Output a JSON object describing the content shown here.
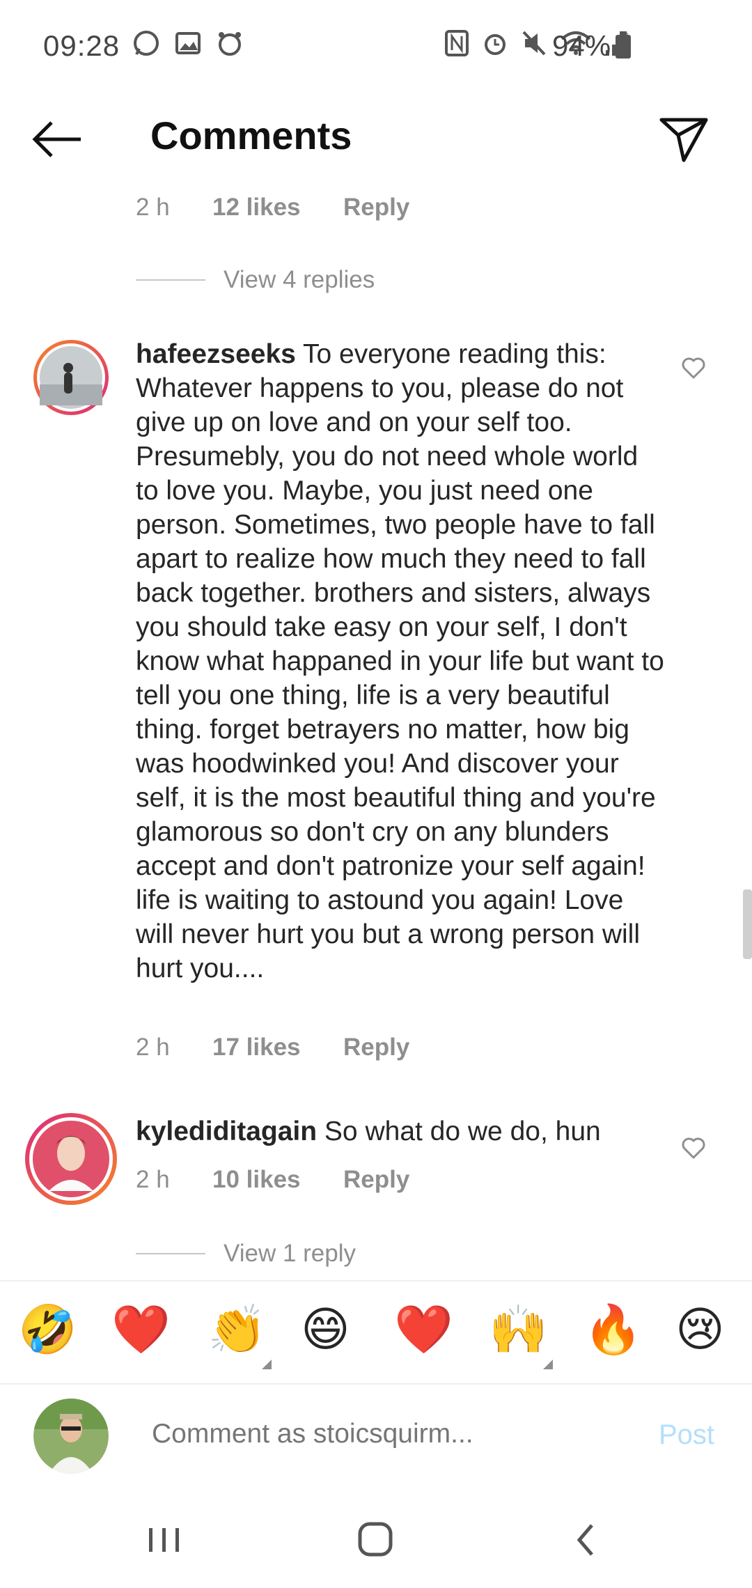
{
  "status_bar": {
    "time": "09:28",
    "battery": "94%",
    "left_icons": [
      "whatsapp-icon",
      "gallery-icon",
      "alarm-app-icon"
    ],
    "right_icons": [
      "nfc-icon",
      "alarm-icon",
      "mute-icon",
      "wifi-icon",
      "signal-icon",
      "battery-icon"
    ]
  },
  "header": {
    "title": "Comments",
    "back_icon": "arrow-left-icon",
    "share_icon": "send-icon"
  },
  "comments": [
    {
      "time": "2 h",
      "likes": "12 likes",
      "reply": "Reply",
      "view_replies": "View 4 replies"
    },
    {
      "username": "hafeezseeks",
      "text": "To everyone reading this: Whatever happens to you, please do not give up on love and on your self too. Presumebly, you do not need whole world to love you. Maybe, you just need one person. Sometimes, two people have to fall apart to realize how much they need to fall back together. brothers and sisters, always you should take easy on your self, I don't know what happaned in your life but want to tell you one thing, life is a very beautiful thing. forget  betrayers no matter, how big was hoodwinked you! And discover your self, it is the most beautiful thing and you're glamorous so don't cry on any blunders accept and don't patronize your self again! life is waiting to astound you again! Love will never hurt you but a wrong person will hurt you....",
      "time": "2 h",
      "likes": "17 likes",
      "reply": "Reply"
    },
    {
      "username": "kylediditagain",
      "text": "So what do we do, hun",
      "time": "2 h",
      "likes": "10 likes",
      "reply": "Reply",
      "view_replies": "View 1 reply"
    }
  ],
  "emoji_bar": [
    "🤣",
    "❤️",
    "👏",
    "😄",
    "❤️",
    "🙌",
    "🔥",
    "😢"
  ],
  "composer": {
    "placeholder": "Comment as stoicsquirm...",
    "post_label": "Post"
  },
  "nav_bar": [
    "recents-icon",
    "home-icon",
    "back-icon"
  ],
  "colors": {
    "text": "#262626",
    "muted": "#8e8e8e",
    "post_disabled": "#b2dffc",
    "story_ring_start": "#f58529",
    "story_ring_end": "#dd2a7b"
  }
}
